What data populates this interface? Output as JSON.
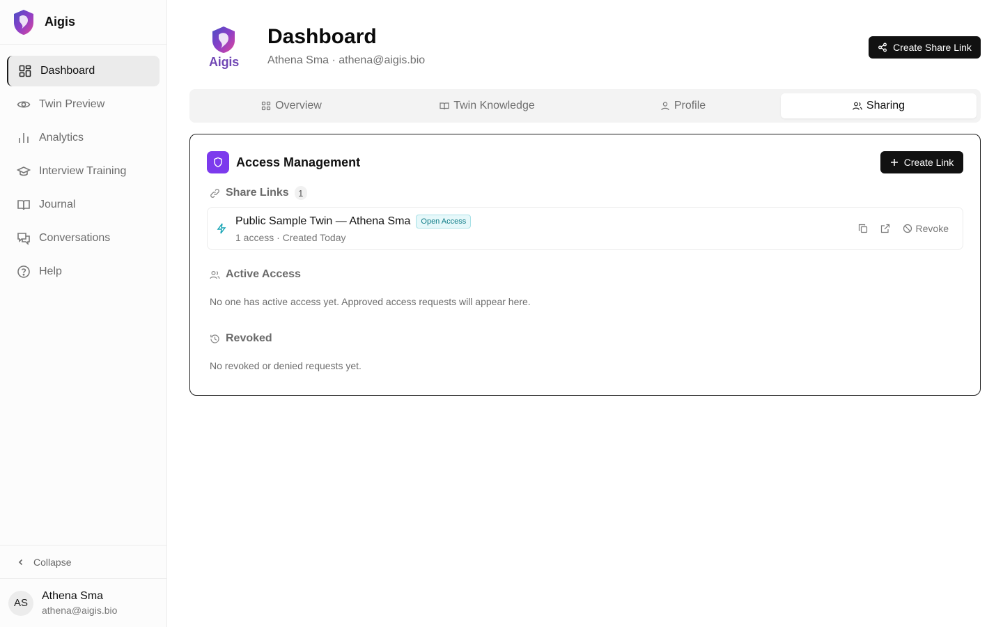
{
  "brand": {
    "name": "Aigis"
  },
  "sidebar": {
    "items": [
      {
        "label": "Dashboard",
        "icon": "layout-grid-icon",
        "active": true
      },
      {
        "label": "Twin Preview",
        "icon": "eye-icon"
      },
      {
        "label": "Analytics",
        "icon": "bar-chart-icon"
      },
      {
        "label": "Interview Training",
        "icon": "graduation-cap-icon"
      },
      {
        "label": "Journal",
        "icon": "book-open-icon"
      },
      {
        "label": "Conversations",
        "icon": "messages-icon"
      },
      {
        "label": "Help",
        "icon": "help-circle-icon"
      }
    ],
    "collapse_label": "Collapse"
  },
  "user": {
    "initials": "AS",
    "name": "Athena Sma",
    "email": "athena@aigis.bio"
  },
  "header": {
    "logo_text": "Aigis",
    "title": "Dashboard",
    "subtitle": "Athena Sma · athena@aigis.bio",
    "share_button": "Create Share Link"
  },
  "tabs": [
    {
      "label": "Overview",
      "icon": "grid-icon"
    },
    {
      "label": "Twin Knowledge",
      "icon": "book-icon"
    },
    {
      "label": "Profile",
      "icon": "user-icon"
    },
    {
      "label": "Sharing",
      "icon": "users-icon",
      "active": true
    }
  ],
  "access": {
    "title": "Access Management",
    "create_button": "Create Link",
    "share_links": {
      "heading": "Share Links",
      "count": "1",
      "items": [
        {
          "title": "Public Sample Twin — Athena Sma",
          "badge": "Open Access",
          "meta": "1 access · Created Today",
          "revoke_label": "Revoke"
        }
      ]
    },
    "active": {
      "heading": "Active Access",
      "empty": "No one has active access yet. Approved access requests will appear here."
    },
    "revoked": {
      "heading": "Revoked",
      "empty": "No revoked or denied requests yet."
    }
  },
  "colors": {
    "accent": "#7c3aed",
    "brand_text": "#7046b4",
    "badge_teal": "#0d7b86",
    "primary_button": "#111111"
  }
}
